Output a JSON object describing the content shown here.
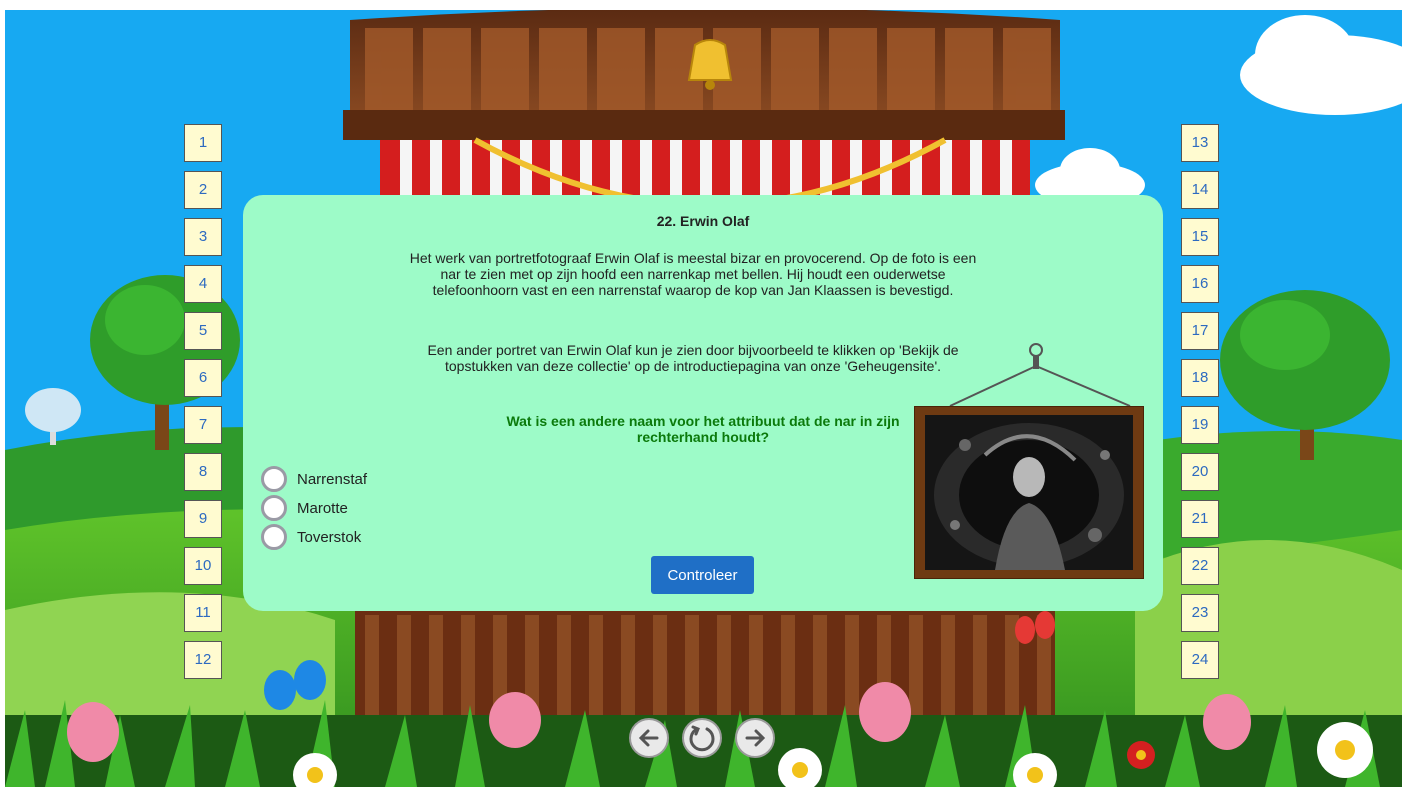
{
  "quiz": {
    "title": "22. Erwin Olaf",
    "paragraph1": "Het werk van portretfotograaf Erwin Olaf is meestal bizar en provocerend. Op de foto is een nar te zien met op zijn hoofd een narrenkap met bellen. Hij houdt een ouderwetse telefoonhoorn vast en een narrenstaf waarop de kop van Jan Klaassen is bevestigd.",
    "paragraph2": "Een ander portret van Erwin Olaf kun je zien door bijvoorbeeld te klikken op 'Bekijk de topstukken van deze collectie' op de introductiepagina van onze 'Geheugensite'.",
    "question": "Wat is een andere naam voor het attribuut dat de nar in zijn rechterhand houdt?",
    "options": [
      "Narrenstaf",
      "Marotte",
      "Toverstok"
    ],
    "check_label": "Controleer"
  },
  "left_numbers": [
    "1",
    "2",
    "3",
    "4",
    "5",
    "6",
    "7",
    "8",
    "9",
    "10",
    "11",
    "12"
  ],
  "right_numbers": [
    "13",
    "14",
    "15",
    "16",
    "17",
    "18",
    "19",
    "20",
    "21",
    "22",
    "23",
    "24"
  ],
  "nav": {
    "prev_icon": "arrow-left-icon",
    "restart_icon": "restart-icon",
    "next_icon": "arrow-right-icon"
  },
  "colors": {
    "panel": "#9dfbc8",
    "question": "#0b7a0b",
    "number_tile": "#fffbd0",
    "number_text": "#2d6ac0",
    "button": "#1f6fc6",
    "sky": "#17a9f2"
  }
}
